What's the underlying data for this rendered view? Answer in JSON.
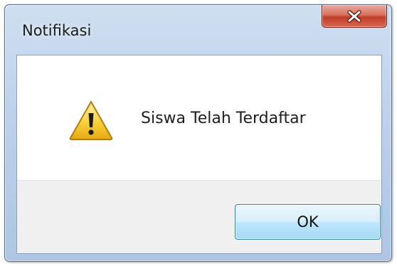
{
  "dialog": {
    "title": "Notifikasi",
    "close_icon": "close-x-icon",
    "message_icon": "warning-icon",
    "message": "Siswa Telah Terdaftar",
    "ok_label": "OK"
  },
  "colors": {
    "close_button": "#c94a33",
    "ok_button_border": "#3c7fb1",
    "warning_fill": "#f6c62a"
  }
}
